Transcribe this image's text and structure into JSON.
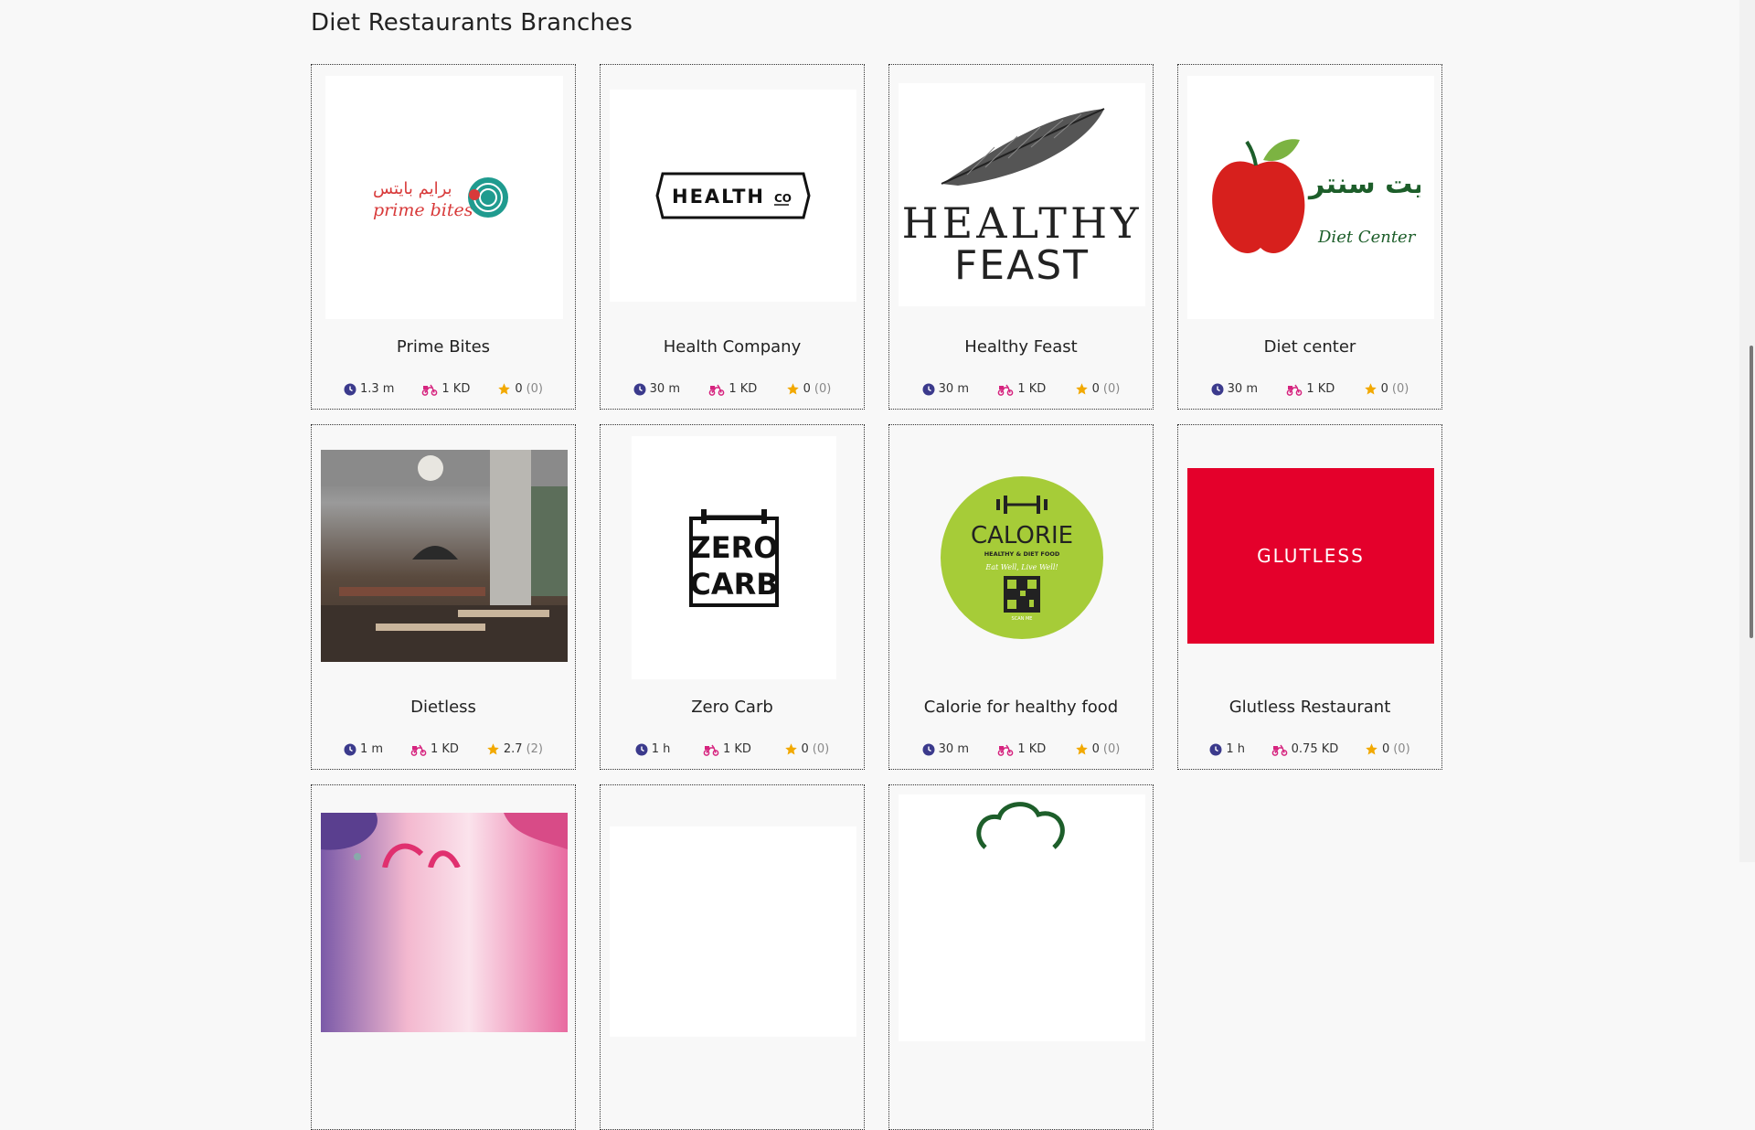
{
  "page": {
    "title": "Diet Restaurants Branches"
  },
  "restaurants": [
    {
      "name": "Prime Bites",
      "time": "1.3 m",
      "fee": "1 KD",
      "rating": "0",
      "reviews": "(0)",
      "logo_text": "prime bites",
      "logo_text_ar": "برايم بايتس"
    },
    {
      "name": "Health Company",
      "time": "30 m",
      "fee": "1 KD",
      "rating": "0",
      "reviews": "(0)",
      "logo_text": "HEALTH",
      "logo_text_small": "CO"
    },
    {
      "name": "Healthy Feast",
      "time": "30 m",
      "fee": "1 KD",
      "rating": "0",
      "reviews": "(0)",
      "logo_text": "HEALTHY",
      "logo_text2": "FEAST"
    },
    {
      "name": "Diet center",
      "time": "30 m",
      "fee": "1 KD",
      "rating": "0",
      "reviews": "(0)",
      "logo_text": "Diet Center",
      "logo_text_ar": "دايت سنتر"
    },
    {
      "name": "Dietless",
      "time": "1 m",
      "fee": "1 KD",
      "rating": "2.7",
      "reviews": "(2)"
    },
    {
      "name": "Zero Carb",
      "time": "1 h",
      "fee": "1 KD",
      "rating": "0",
      "reviews": "(0)",
      "logo_text": "ZERO",
      "logo_text2": "CARB"
    },
    {
      "name": "Calorie for healthy food",
      "time": "30 m",
      "fee": "1 KD",
      "rating": "0",
      "reviews": "(0)",
      "logo_text": "CALORIE",
      "logo_sub": "HEALTHY & DIET FOOD",
      "logo_slogan": "Eat Well, Live Well!",
      "logo_scan": "SCAN ME"
    },
    {
      "name": "Glutless Restaurant",
      "time": "1 h",
      "fee": "0.75 KD",
      "rating": "0",
      "reviews": "(0)",
      "logo_text": "GLUTLESS"
    }
  ],
  "colors": {
    "clock_icon": "#3b3a8c",
    "delivery_icon": "#d6247f",
    "star_icon": "#f2a900",
    "glutless_bg": "#e4002b",
    "calorie_bg": "#a6cc38",
    "prime_red": "#d83a3a",
    "prime_teal": "#1f9b8f",
    "diet_green": "#1d5e2a",
    "apple_red": "#d7201d"
  }
}
